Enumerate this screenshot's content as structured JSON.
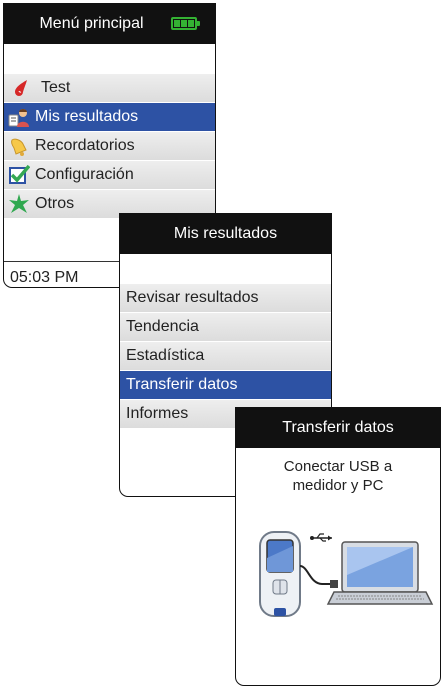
{
  "main_menu": {
    "title": "Menú principal",
    "items": [
      {
        "label": "Test",
        "icon": "blood-drop-icon",
        "selected": false
      },
      {
        "label": "Mis resultados",
        "icon": "results-person-icon",
        "selected": true
      },
      {
        "label": "Recordatorios",
        "icon": "bell-icon",
        "selected": false
      },
      {
        "label": "Configuración",
        "icon": "checkbox-icon",
        "selected": false
      },
      {
        "label": "Otros",
        "icon": "star-icon",
        "selected": false
      }
    ],
    "time": "05:03 PM",
    "battery_level": 3
  },
  "results_menu": {
    "title": "Mis resultados",
    "items": [
      {
        "label": "Revisar resultados",
        "selected": false
      },
      {
        "label": "Tendencia",
        "selected": false
      },
      {
        "label": "Estadística",
        "selected": false
      },
      {
        "label": "Transferir datos",
        "selected": true
      },
      {
        "label": "Informes",
        "selected": false
      }
    ]
  },
  "transfer_screen": {
    "title": "Transferir datos",
    "instruction_line1": "Conectar USB a",
    "instruction_line2": "medidor y PC"
  },
  "colors": {
    "selected": "#2d52a4",
    "battery": "#34b233",
    "header": "#111111"
  }
}
